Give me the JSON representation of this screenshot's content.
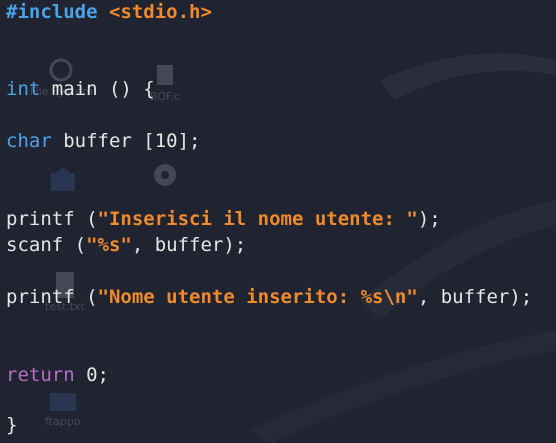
{
  "desktop_icons": [
    {
      "name": "file-system",
      "label": "File System"
    },
    {
      "name": "boot",
      "label": "BOF.c"
    },
    {
      "name": "home",
      "label": ""
    },
    {
      "name": "settings",
      "label": ""
    },
    {
      "name": "test-file",
      "label": "test.txt"
    },
    {
      "name": "folder",
      "label": "ftappo"
    }
  ],
  "code": {
    "include_kw": "#include",
    "include_header": "<stdio.h>",
    "int_kw": "int",
    "main_sig": " main () {",
    "char_kw": "char",
    "buffer_decl": " buffer [10];",
    "printf1_pre": "printf (",
    "printf1_str": "\"Inserisci il nome utente: \"",
    "printf1_post": ");",
    "scanf_pre": "scanf (",
    "scanf_str": "\"%s\"",
    "scanf_post": ", buffer);",
    "printf2_pre": "printf (",
    "printf2_str": "\"Nome utente inserito: %s\\n\"",
    "printf2_post": ", buffer);",
    "return_kw": "return",
    "return_val": " 0;",
    "closing_brace": "}"
  },
  "colors": {
    "background": "#202330",
    "preprocessor": "#4aa3e8",
    "string": "#f08a2c",
    "type": "#4aa3e8",
    "return": "#b46fc6",
    "text": "#e6e6e6"
  }
}
